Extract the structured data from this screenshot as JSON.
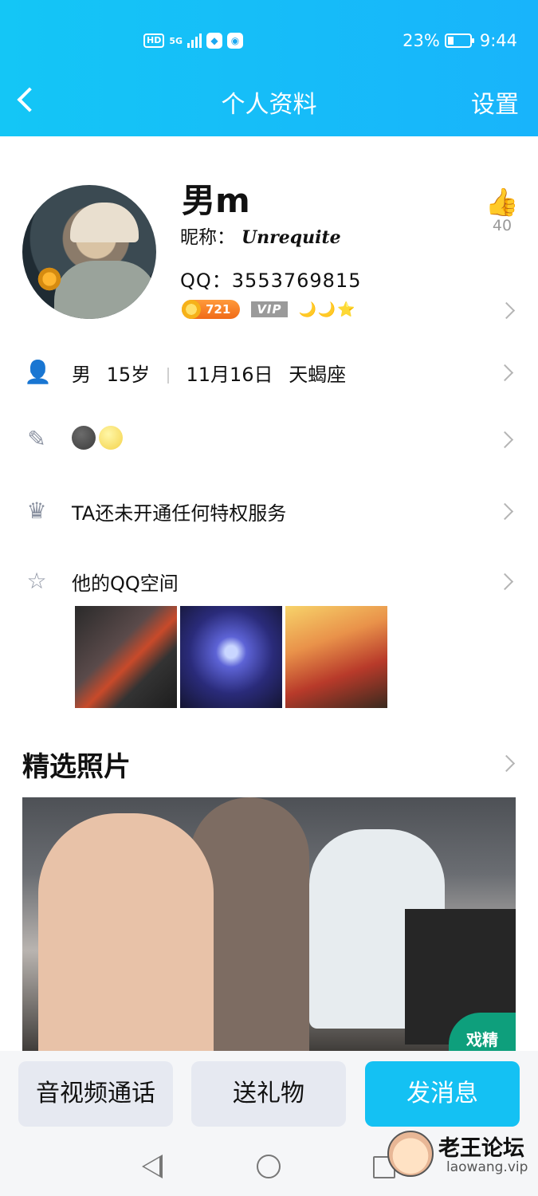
{
  "status": {
    "network": "HD",
    "signal": "5G",
    "battery": "23%",
    "time": "9:44"
  },
  "nav": {
    "title": "个人资料",
    "settings": "设置"
  },
  "profile": {
    "name": "男m",
    "nickname_label": "昵称：",
    "nickname": "Unrequite",
    "qq_label": "QQ：",
    "qq_number": "3553769815",
    "coin": "721",
    "vip": "VIP",
    "level_icons": "🌙🌙⭐",
    "likes": "40"
  },
  "rows": {
    "info": {
      "gender": "男",
      "age": "15岁",
      "birthday": "11月16日",
      "zodiac": "天蝎座"
    },
    "signature": "🌚🌝",
    "privilege": "TA还未开通任何特权服务",
    "qzone": "他的QQ空间"
  },
  "featured": {
    "title": "精选照片",
    "badge": "戏精"
  },
  "actions": {
    "call": "音视频通话",
    "gift": "送礼物",
    "message": "发消息"
  },
  "watermark": {
    "title": "老王论坛",
    "url": "laowang.vip"
  },
  "colors": {
    "accent": "#14c1f3",
    "header": "#18b4fb"
  }
}
